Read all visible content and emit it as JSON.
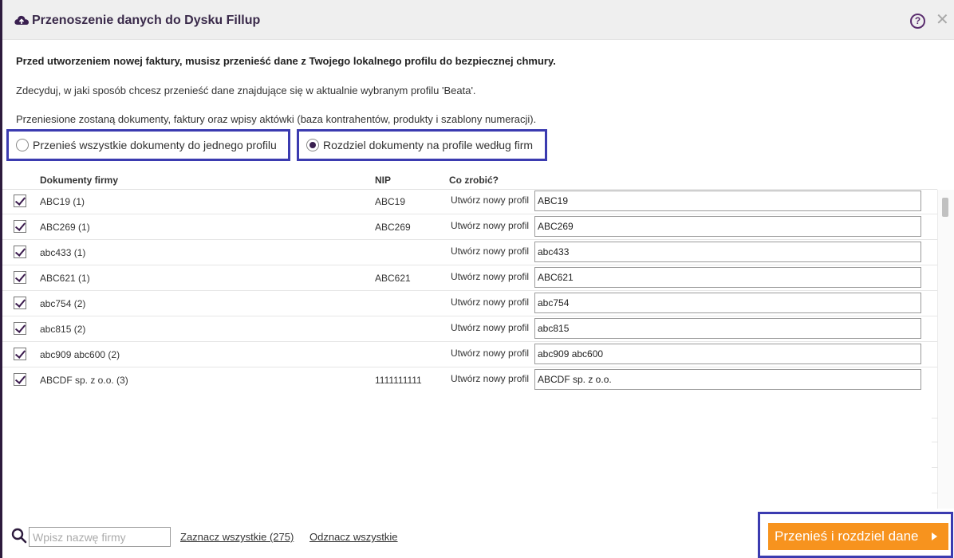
{
  "dialog": {
    "title": "Przenoszenie danych do Dysku Fillup",
    "help_label": "?",
    "close_label": "✕"
  },
  "content": {
    "intro_bold": "Przed utworzeniem nowej faktury, musisz przenieść dane z Twojego lokalnego profilu do bezpiecznej chmury.",
    "intro_decide": "Zdecyduj, w jaki sposób chcesz przenieść dane znajdujące się w aktualnie wybranym profilu 'Beata'.",
    "intro_info": "Przeniesione zostaną dokumenty, faktury oraz wpisy aktówki (baza kontrahentów, produkty i szablony numeracji)."
  },
  "options": {
    "single_profile": {
      "label": "Przenieś wszystkie dokumenty do jednego profilu",
      "selected": false
    },
    "split_profiles": {
      "label": "Rozdziel dokumenty na profile według firm",
      "selected": true
    }
  },
  "table": {
    "headers": {
      "company": "Dokumenty firmy",
      "nip": "NIP",
      "action": "Co zrobić?"
    },
    "rows": [
      {
        "name": "ABC19 (1)",
        "nip": "ABC19",
        "action": "Utwórz nowy profil",
        "profile": "ABC19",
        "checked": true
      },
      {
        "name": "ABC269 (1)",
        "nip": "ABC269",
        "action": "Utwórz nowy profil",
        "profile": "ABC269",
        "checked": true
      },
      {
        "name": "abc433 (1)",
        "nip": "",
        "action": "Utwórz nowy profil",
        "profile": "abc433",
        "checked": true
      },
      {
        "name": "ABC621 (1)",
        "nip": "ABC621",
        "action": "Utwórz nowy profil",
        "profile": "ABC621",
        "checked": true
      },
      {
        "name": "abc754 (2)",
        "nip": "",
        "action": "Utwórz nowy profil",
        "profile": "abc754",
        "checked": true
      },
      {
        "name": "abc815 (2)",
        "nip": "",
        "action": "Utwórz nowy profil",
        "profile": "abc815",
        "checked": true
      },
      {
        "name": "abc909 abc600 (2)",
        "nip": "",
        "action": "Utwórz nowy profil",
        "profile": "abc909 abc600",
        "checked": true
      },
      {
        "name": "ABCDF sp. z o.o. (3)",
        "nip": "1111111111",
        "action": "Utwórz nowy profil",
        "profile": "ABCDF sp. z o.o.",
        "checked": true
      }
    ]
  },
  "footer": {
    "search_placeholder": "Wpisz nazwę firmy",
    "select_all": "Zaznacz wszystkie (275)",
    "deselect_all": "Odznacz wszystkie",
    "submit_label": "Przenieś i rozdziel dane"
  },
  "colors": {
    "accent": "#f7931e",
    "brand": "#3a2a4a",
    "highlight_border": "#3b3bb0"
  }
}
